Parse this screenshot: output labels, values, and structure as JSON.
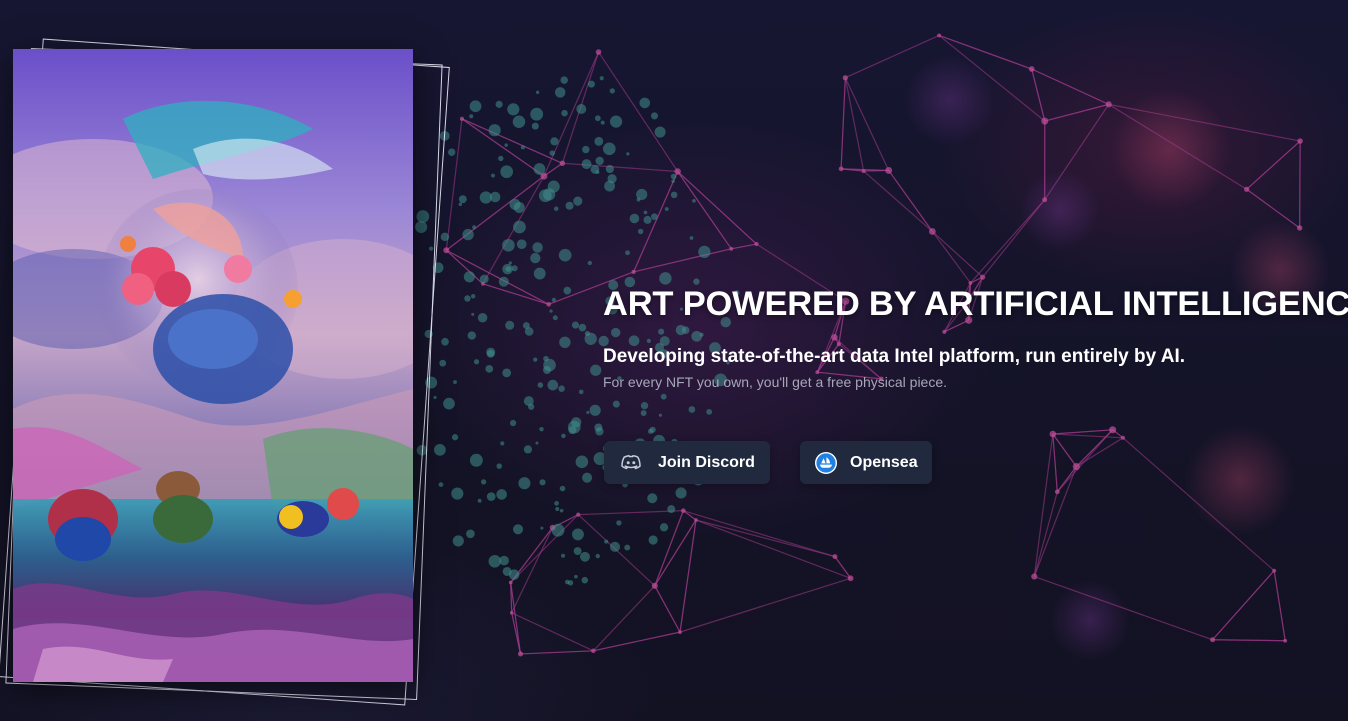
{
  "hero": {
    "title": "ART POWERED BY ARTIFICIAL INTELLIGENCE",
    "subtitle": "Developing state-of-the-art data Intel platform, run entirely by AI.",
    "note": "For every NFT you own, you'll get a free physical piece."
  },
  "buttons": {
    "discord": {
      "label": "Join Discord",
      "icon": "discord-icon"
    },
    "opensea": {
      "label": "Opensea",
      "icon": "opensea-icon"
    }
  },
  "colors": {
    "background": "#15142a",
    "button_bg": "#20293e",
    "opensea_blue": "#2081e2",
    "network_pink": "#a23a8a",
    "network_teal": "#3f8f8c"
  }
}
